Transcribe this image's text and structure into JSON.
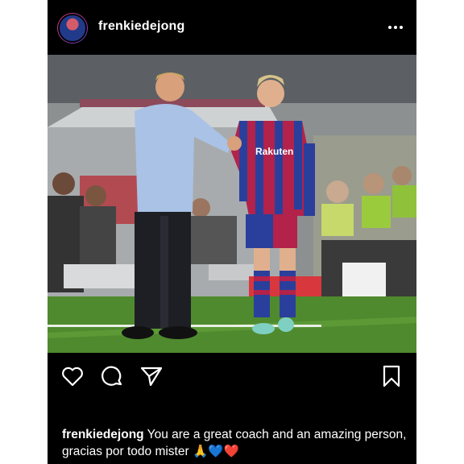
{
  "post": {
    "username": "frenkiedejong",
    "caption_text": "You are a great coach and an amazing person, gracias por todo mister",
    "caption_emojis": "🙏💙❤️"
  },
  "photo": {
    "shirt_sponsor": "Rakuten"
  },
  "icons": [
    "avatar",
    "more-options-icon",
    "heart-icon",
    "comment-icon",
    "share-icon",
    "bookmark-icon"
  ],
  "colors": {
    "background": "#000000",
    "text": "#ffffff",
    "grass": "#4f8a2e",
    "kit_blue": "#2a3f9c",
    "kit_red": "#b3224a"
  }
}
